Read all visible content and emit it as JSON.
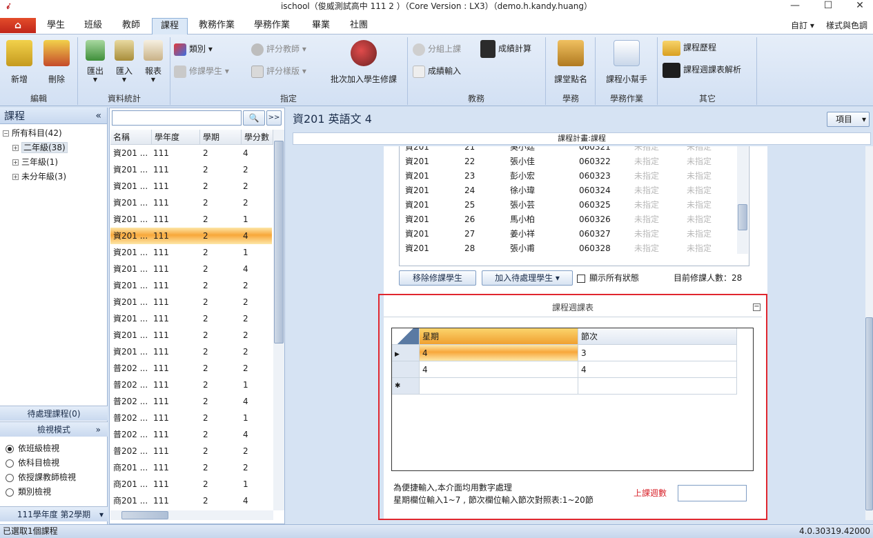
{
  "window": {
    "title": "ischool（俊威測試高中 111 2 ）（Core Version : LX3）（demo.h.kandy.huang）",
    "minimize": "—",
    "maximize": "☐",
    "close": "✕"
  },
  "ribbon": {
    "tabs": [
      "學生",
      "班級",
      "教師",
      "課程",
      "教務作業",
      "學務作業",
      "畢業",
      "社團"
    ],
    "active_tab": "課程",
    "top_right": [
      "自訂",
      "樣式與色調"
    ],
    "groups": {
      "edit": {
        "label": "編輯",
        "add": "新增",
        "delete": "刪除"
      },
      "stats": {
        "label": "資料統計",
        "export": "匯出",
        "import": "匯入",
        "report": "報表"
      },
      "assign": {
        "label": "指定",
        "category": "類別",
        "teacher": "評分教師",
        "students": "修課學生",
        "template": "評分樣版",
        "batch_add": "批次加入學生修課"
      },
      "academic": {
        "label": "教務",
        "group_class": "分組上課",
        "score_calc": "成績計算",
        "score_input": "成績輸入"
      },
      "discipline": {
        "label": "學務",
        "rollcall": "課堂點名"
      },
      "academic_ops": {
        "label": "學務作業",
        "helper": "課程小幫手"
      },
      "other": {
        "label": "其它",
        "history": "課程歷程",
        "schedule_parse": "課程週課表解析"
      }
    }
  },
  "sidebar": {
    "title": "課程",
    "collapse": "«",
    "tree": [
      "所有科目(42)",
      "二年級(38)",
      "三年級(1)",
      "未分年級(3)"
    ],
    "pending": "待處理課程(0)",
    "view_mode": "檢視模式",
    "view_options": [
      "依班級檢視",
      "依科目檢視",
      "依授課教師檢視",
      "類別檢視"
    ],
    "semester": "111學年度 第2學期"
  },
  "course_list": {
    "search_placeholder": "",
    "search_icon": "🔍",
    "expand": ">>",
    "headers": [
      "名稱",
      "學年度",
      "學期",
      "學分數"
    ],
    "rows": [
      [
        "資201 ...",
        "111",
        "2",
        "4"
      ],
      [
        "資201 ...",
        "111",
        "2",
        "2"
      ],
      [
        "資201 ...",
        "111",
        "2",
        "2"
      ],
      [
        "資201 ...",
        "111",
        "2",
        "2"
      ],
      [
        "資201 ...",
        "111",
        "2",
        "1"
      ],
      [
        "資201 ...",
        "111",
        "2",
        "4"
      ],
      [
        "資201 ...",
        "111",
        "2",
        "1"
      ],
      [
        "資201 ...",
        "111",
        "2",
        "4"
      ],
      [
        "資201 ...",
        "111",
        "2",
        "2"
      ],
      [
        "資201 ...",
        "111",
        "2",
        "2"
      ],
      [
        "資201 ...",
        "111",
        "2",
        "2"
      ],
      [
        "資201 ...",
        "111",
        "2",
        "2"
      ],
      [
        "資201 ...",
        "111",
        "2",
        "2"
      ],
      [
        "普202 ...",
        "111",
        "2",
        "2"
      ],
      [
        "普202 ...",
        "111",
        "2",
        "1"
      ],
      [
        "普202 ...",
        "111",
        "2",
        "4"
      ],
      [
        "普202 ...",
        "111",
        "2",
        "1"
      ],
      [
        "普202 ...",
        "111",
        "2",
        "4"
      ],
      [
        "普202 ...",
        "111",
        "2",
        "2"
      ],
      [
        "商201 ...",
        "111",
        "2",
        "2"
      ],
      [
        "商201 ...",
        "111",
        "2",
        "1"
      ],
      [
        "商201 ...",
        "111",
        "2",
        "4"
      ]
    ],
    "selected_index": 5
  },
  "main": {
    "title": "資201 英語文 4",
    "items_button": "項目",
    "plan_label": "課程計畫:課程",
    "students": [
      [
        "資201",
        "21",
        "吳小廷",
        "060321",
        "未指定",
        "未指定"
      ],
      [
        "資201",
        "22",
        "張小佳",
        "060322",
        "未指定",
        "未指定"
      ],
      [
        "資201",
        "23",
        "彭小宏",
        "060323",
        "未指定",
        "未指定"
      ],
      [
        "資201",
        "24",
        "徐小瑋",
        "060324",
        "未指定",
        "未指定"
      ],
      [
        "資201",
        "25",
        "張小芸",
        "060325",
        "未指定",
        "未指定"
      ],
      [
        "資201",
        "26",
        "馬小柏",
        "060326",
        "未指定",
        "未指定"
      ],
      [
        "資201",
        "27",
        "姜小祥",
        "060327",
        "未指定",
        "未指定"
      ],
      [
        "資201",
        "28",
        "張小甫",
        "060328",
        "未指定",
        "未指定"
      ]
    ],
    "remove_btn": "移除修課學生",
    "add_pending_btn": "加入待處理學生",
    "show_all_label": "顯示所有狀態",
    "count_label": "目前修課人數：28",
    "schedule": {
      "title": "課程週課表",
      "headers": [
        "星期",
        "節次"
      ],
      "rows": [
        [
          "4",
          "3"
        ],
        [
          "4",
          "4"
        ]
      ],
      "note1": "為便捷輸入,本介面均用數字處理",
      "note2": "星期欄位輸入1~7 , 節次欄位輸入節次對照表:1~20節",
      "weeks_label": "上課週數",
      "weeks_value": ""
    }
  },
  "status": {
    "left": "已選取1個課程",
    "right": "4.0.30319.42000"
  },
  "colors": {
    "highlight": "#f8a73a",
    "frame": "#e0262e",
    "accent": "#1b2d4a"
  }
}
